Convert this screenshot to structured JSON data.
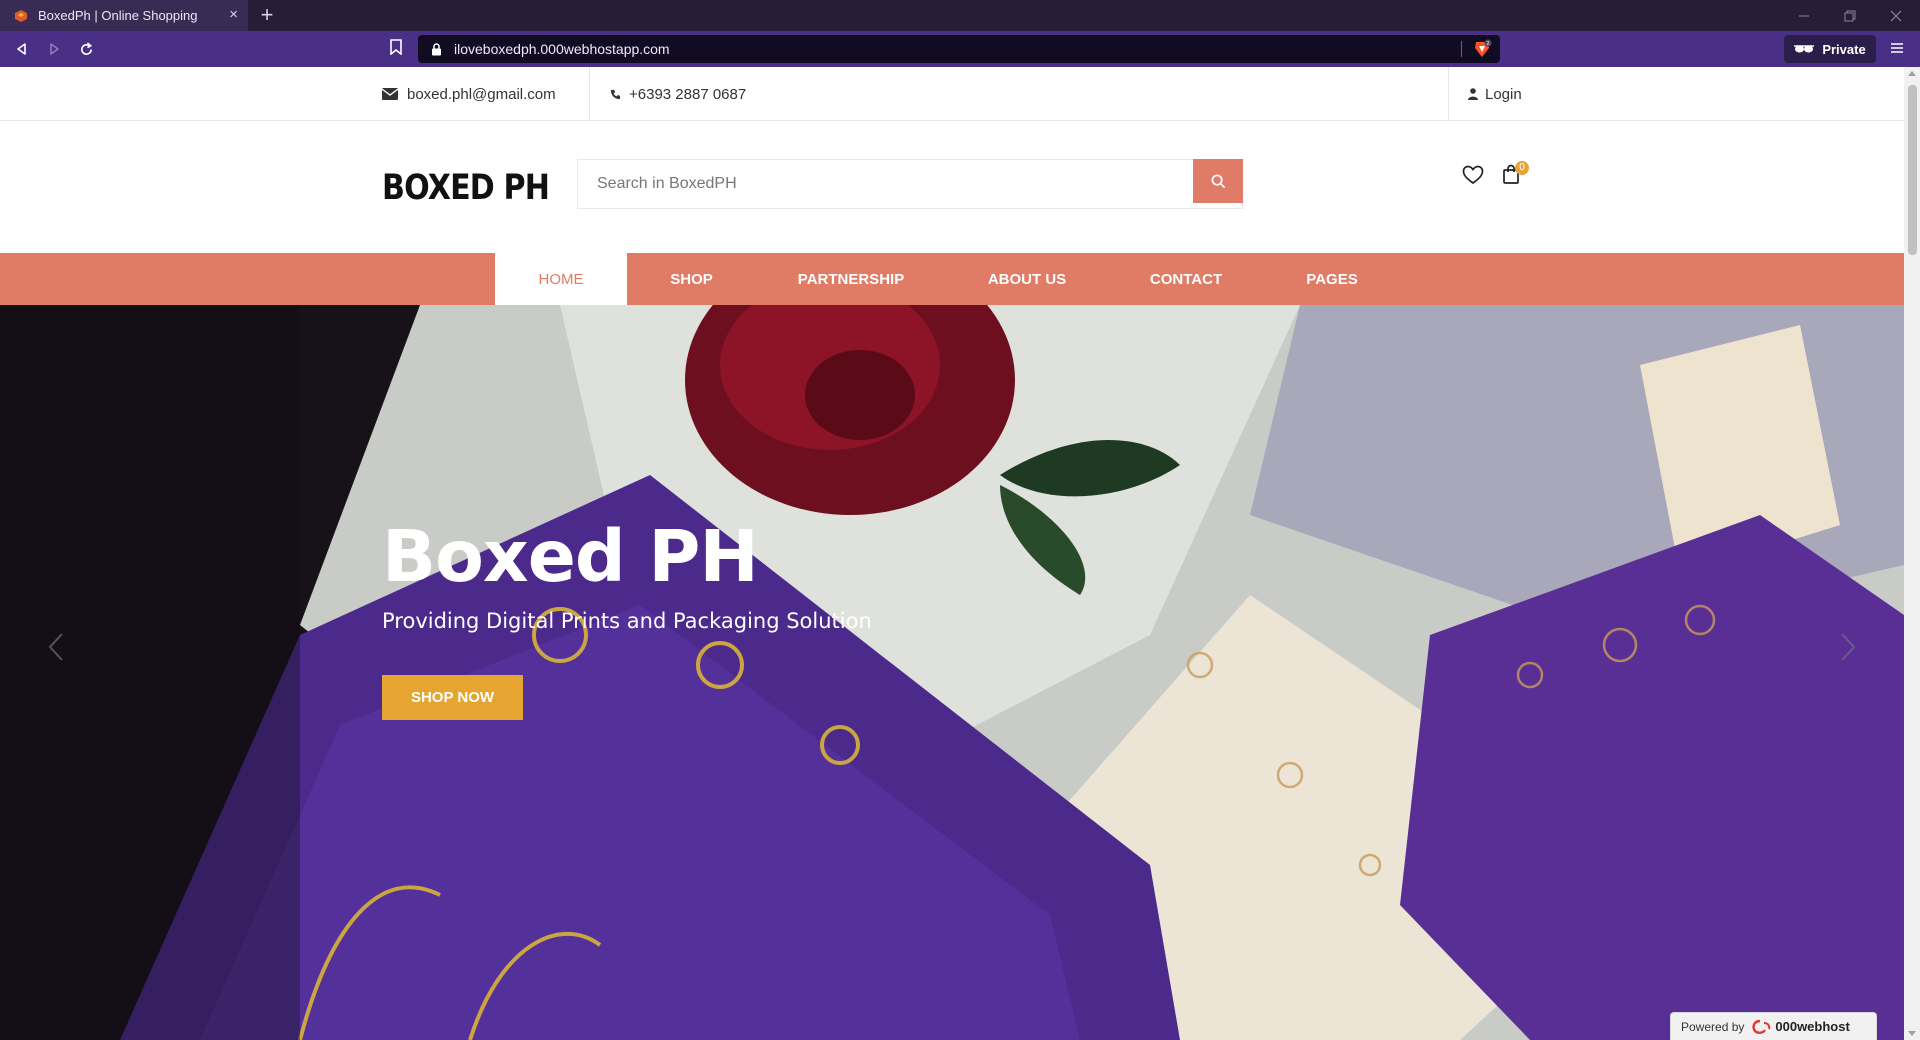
{
  "browser": {
    "tab_title": "BoxedPh | Online Shopping",
    "tab_close": "×",
    "new_tab": "+",
    "url": "iloveboxedph.000webhostapp.com",
    "private_label": "Private"
  },
  "topbar": {
    "email": "boxed.phl@gmail.com",
    "phone": "+6393 2887 0687",
    "login": "Login"
  },
  "header": {
    "logo": "BOXED PH",
    "search_placeholder": "Search in BoxedPH",
    "cart_count": "0"
  },
  "nav": {
    "items": [
      {
        "label": "HOME",
        "active": true
      },
      {
        "label": "SHOP"
      },
      {
        "label": "PARTNERSHIP"
      },
      {
        "label": "ABOUT US"
      },
      {
        "label": "CONTACT"
      },
      {
        "label": "PAGES"
      }
    ]
  },
  "hero": {
    "title": "Boxed PH",
    "subtitle": "Providing Digital Prints and Packaging Solution",
    "cta": "SHOP NOW"
  },
  "footer_badge": {
    "powered_by": "Powered by",
    "brand": "000webhost"
  },
  "colors": {
    "accent": "#e07b66",
    "cta": "#e5a530",
    "browser_toolbar": "#4a2f86"
  }
}
